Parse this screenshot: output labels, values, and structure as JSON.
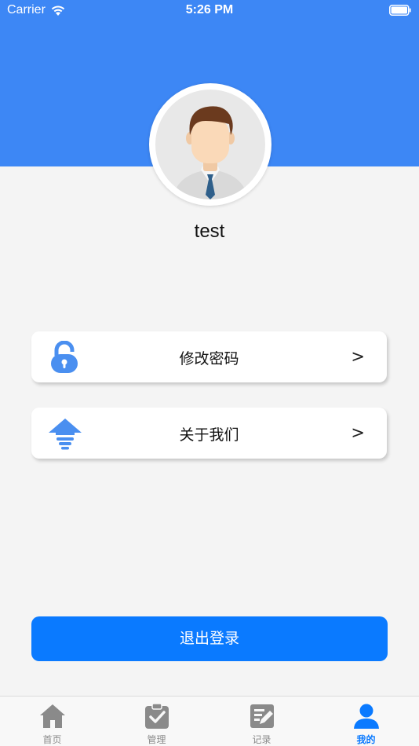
{
  "status_bar": {
    "carrier": "Carrier",
    "time": "5:26 PM"
  },
  "colors": {
    "header": "#3d87f5",
    "primary": "#0a7aff",
    "background": "#f4f4f4"
  },
  "profile": {
    "username": "test",
    "avatar_icon": "user-avatar"
  },
  "menu": {
    "items": [
      {
        "label": "修改密码",
        "icon": "unlock-icon",
        "arrow": ">"
      },
      {
        "label": "关于我们",
        "icon": "upload-arrow-icon",
        "arrow": ">"
      }
    ]
  },
  "logout": {
    "label": "退出登录"
  },
  "tabbar": {
    "items": [
      {
        "label": "首页",
        "icon": "home-icon",
        "active": false
      },
      {
        "label": "管理",
        "icon": "clipboard-check-icon",
        "active": false
      },
      {
        "label": "记录",
        "icon": "edit-note-icon",
        "active": false
      },
      {
        "label": "我的",
        "icon": "person-icon",
        "active": true
      }
    ]
  }
}
